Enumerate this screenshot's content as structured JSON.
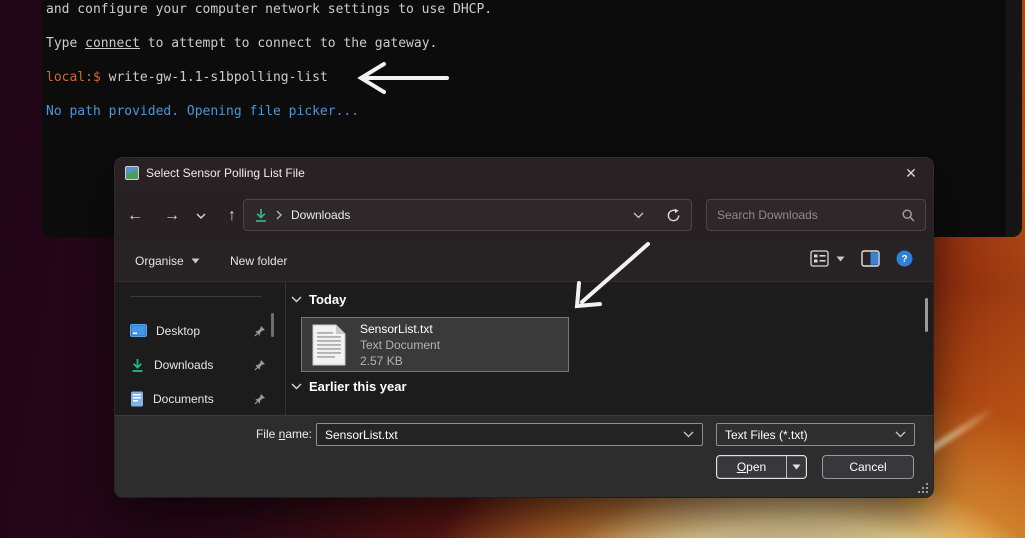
{
  "terminal": {
    "line1": "and configure your computer network settings to use DHCP.",
    "line2_pre": "Type ",
    "line2_link": "connect",
    "line2_post": " to attempt to connect to the gateway.",
    "prompt": "local:$ ",
    "command": "write-gw-1.1-s1bpolling-list",
    "line4": "No path provided. Opening file picker...",
    "colors": {
      "background": "#0c0c0c",
      "text": "#cccccc",
      "prompt_orange": "#cf6a36",
      "info_blue": "#4e94d7"
    }
  },
  "dialog": {
    "title": "Select Sensor Polling List File",
    "nav": {
      "location": "Downloads",
      "search_placeholder": "Search Downloads"
    },
    "toolbar": {
      "organise_label": "Organise",
      "new_folder_label": "New folder"
    },
    "sidebar": {
      "items": [
        {
          "label": "Desktop",
          "icon": "desktop-icon",
          "pinned": true
        },
        {
          "label": "Downloads",
          "icon": "downloads-icon",
          "pinned": true
        },
        {
          "label": "Documents",
          "icon": "documents-icon",
          "pinned": true
        }
      ]
    },
    "files": {
      "groups": [
        {
          "label": "Today"
        },
        {
          "label": "Earlier this year"
        }
      ],
      "selected_file": {
        "name": "SensorList.txt",
        "type": "Text Document",
        "size": "2.57 KB",
        "icon": "text-file-icon"
      }
    },
    "footer": {
      "file_name_label_pre": "File ",
      "file_name_label_key": "n",
      "file_name_label_post": "ame:",
      "file_name_value": "SensorList.txt",
      "file_type_value": "Text Files (*.txt)",
      "open_key": "O",
      "open_rest": "pen",
      "cancel_label": "Cancel"
    },
    "colors": {
      "accent_blue": "#2f7fd6",
      "teal": "#2fb380",
      "selection_bg": "#3a3a3a",
      "selection_border": "#777777"
    }
  }
}
